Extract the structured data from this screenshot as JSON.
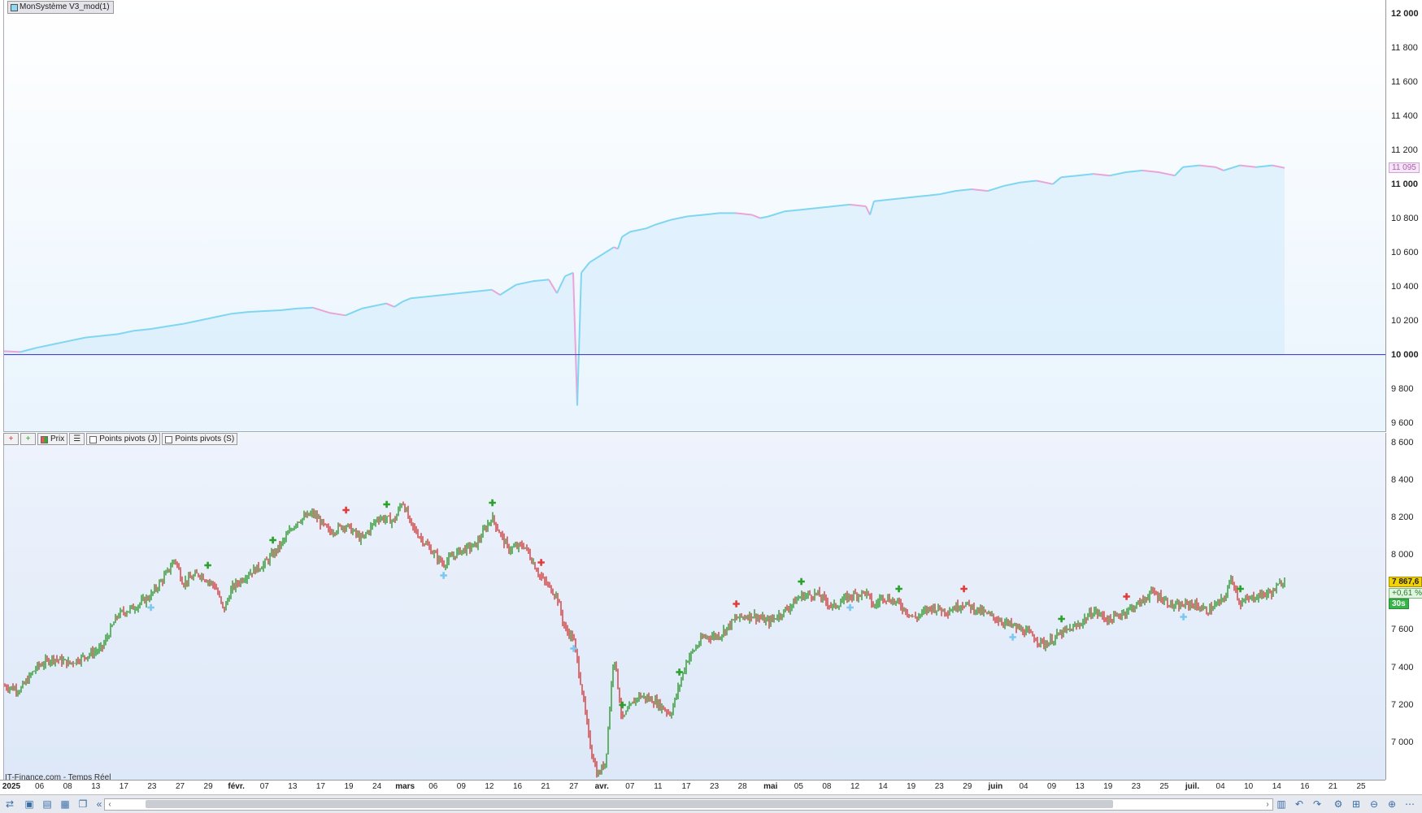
{
  "indicator": {
    "name": "MonSystème V3_mod(1)"
  },
  "upper_axis": {
    "ticks": [
      "12 000",
      "11 800",
      "11 600",
      "11 400",
      "11 200",
      "11 000",
      "10 800",
      "10 600",
      "10 400",
      "10 200",
      "10 000",
      "9 800",
      "9 600"
    ],
    "current_value": "11 095"
  },
  "legend": {
    "add_btn": "+",
    "move_btn": "+",
    "prix": "Prix",
    "list_btn": "☰",
    "pivots_j": "Points pivots (J)",
    "pivots_s": "Points pivots (S)"
  },
  "lower_axis": {
    "ticks": [
      "8 600",
      "8 400",
      "8 200",
      "8 000",
      "7 800",
      "7 600",
      "7 400",
      "7 200",
      "7 000"
    ],
    "last_price": "7 867,6",
    "change": "+0,61 %",
    "timer": "30s"
  },
  "source": "IT-Finance.com - Temps Réel",
  "x_axis": {
    "labels": [
      "2025",
      "06",
      "08",
      "13",
      "17",
      "23",
      "27",
      "29",
      "févr.",
      "07",
      "13",
      "17",
      "19",
      "24",
      "mars",
      "06",
      "09",
      "12",
      "16",
      "21",
      "27",
      "avr.",
      "07",
      "11",
      "17",
      "23",
      "28",
      "mai",
      "05",
      "08",
      "12",
      "14",
      "19",
      "23",
      "29",
      "juin",
      "04",
      "09",
      "13",
      "19",
      "23",
      "25",
      "juil.",
      "04",
      "10",
      "14",
      "16",
      "21",
      "25"
    ],
    "major": [
      "2025",
      "févr.",
      "mars",
      "avr.",
      "mai",
      "juin",
      "juil."
    ]
  },
  "colors": {
    "equity_line": "#7fd6f0",
    "equity_fill": "#d9eefc",
    "equity_pink": "#e8a6d8",
    "baseline": "#4646c8",
    "candle_up": "#2f9a2f",
    "candle_down": "#d43c3c",
    "buy_marker": "#2aa12a",
    "sell_marker": "#e23b3b",
    "pivot_marker": "#7cc8f0",
    "last_price_bg": "#f2d200",
    "change_bg": "#dff5df",
    "timer_bg": "#38b54a"
  },
  "chart_data": [
    {
      "type": "area",
      "title": "",
      "ylim": [
        9550,
        12080
      ],
      "baseline": 10000,
      "series": [
        {
          "values": [
            [
              0,
              10020
            ],
            [
              20,
              10015
            ],
            [
              40,
              10040
            ],
            [
              60,
              10060
            ],
            [
              80,
              10080
            ],
            [
              100,
              10100
            ],
            [
              120,
              10110
            ],
            [
              140,
              10120
            ],
            [
              160,
              10140
            ],
            [
              180,
              10150
            ],
            [
              200,
              10165
            ],
            [
              220,
              10180
            ],
            [
              240,
              10200
            ],
            [
              260,
              10220
            ],
            [
              280,
              10240
            ],
            [
              300,
              10250
            ],
            [
              320,
              10255
            ],
            [
              340,
              10260
            ],
            [
              360,
              10270
            ],
            [
              380,
              10275
            ],
            [
              400,
              10245
            ],
            [
              420,
              10230
            ],
            [
              440,
              10270
            ],
            [
              460,
              10290
            ],
            [
              470,
              10300
            ],
            [
              480,
              10280
            ],
            [
              490,
              10310
            ],
            [
              500,
              10330
            ],
            [
              520,
              10340
            ],
            [
              540,
              10350
            ],
            [
              560,
              10360
            ],
            [
              580,
              10370
            ],
            [
              600,
              10380
            ],
            [
              610,
              10350
            ],
            [
              630,
              10410
            ],
            [
              650,
              10430
            ],
            [
              670,
              10440
            ],
            [
              680,
              10360
            ],
            [
              690,
              10460
            ],
            [
              700,
              10480
            ],
            [
              705,
              9700
            ],
            [
              710,
              10480
            ],
            [
              720,
              10540
            ],
            [
              740,
              10600
            ],
            [
              750,
              10630
            ],
            [
              755,
              10620
            ],
            [
              760,
              10690
            ],
            [
              770,
              10720
            ],
            [
              790,
              10740
            ],
            [
              800,
              10760
            ],
            [
              820,
              10790
            ],
            [
              840,
              10810
            ],
            [
              860,
              10820
            ],
            [
              880,
              10830
            ],
            [
              900,
              10830
            ],
            [
              920,
              10820
            ],
            [
              930,
              10800
            ],
            [
              940,
              10810
            ],
            [
              960,
              10840
            ],
            [
              980,
              10850
            ],
            [
              1000,
              10860
            ],
            [
              1020,
              10870
            ],
            [
              1040,
              10880
            ],
            [
              1060,
              10870
            ],
            [
              1065,
              10820
            ],
            [
              1070,
              10900
            ],
            [
              1090,
              10910
            ],
            [
              1110,
              10920
            ],
            [
              1130,
              10930
            ],
            [
              1150,
              10940
            ],
            [
              1170,
              10960
            ],
            [
              1190,
              10970
            ],
            [
              1210,
              10960
            ],
            [
              1230,
              10990
            ],
            [
              1250,
              11010
            ],
            [
              1270,
              11020
            ],
            [
              1290,
              11000
            ],
            [
              1300,
              11040
            ],
            [
              1320,
              11050
            ],
            [
              1340,
              11060
            ],
            [
              1360,
              11050
            ],
            [
              1380,
              11070
            ],
            [
              1400,
              11080
            ],
            [
              1420,
              11070
            ],
            [
              1440,
              11050
            ],
            [
              1450,
              11100
            ],
            [
              1470,
              11110
            ],
            [
              1490,
              11100
            ],
            [
              1500,
              11080
            ],
            [
              1520,
              11110
            ],
            [
              1540,
              11100
            ],
            [
              1560,
              11110
            ],
            [
              1575,
              11095
            ]
          ]
        }
      ]
    },
    {
      "type": "candlestick",
      "title": "",
      "ylim": [
        6800,
        8650
      ],
      "series": [
        {
          "name": "Prix",
          "values": [
            [
              0,
              7300
            ],
            [
              20,
              7280
            ],
            [
              40,
              7400
            ],
            [
              60,
              7450
            ],
            [
              80,
              7420
            ],
            [
              100,
              7460
            ],
            [
              120,
              7500
            ],
            [
              140,
              7680
            ],
            [
              160,
              7720
            ],
            [
              180,
              7780
            ],
            [
              200,
              7900
            ],
            [
              210,
              7980
            ],
            [
              220,
              7850
            ],
            [
              240,
              7900
            ],
            [
              260,
              7830
            ],
            [
              270,
              7700
            ],
            [
              280,
              7820
            ],
            [
              300,
              7900
            ],
            [
              320,
              7950
            ],
            [
              340,
              8050
            ],
            [
              360,
              8180
            ],
            [
              380,
              8220
            ],
            [
              400,
              8120
            ],
            [
              420,
              8160
            ],
            [
              440,
              8080
            ],
            [
              460,
              8200
            ],
            [
              480,
              8180
            ],
            [
              490,
              8290
            ],
            [
              500,
              8160
            ],
            [
              520,
              8050
            ],
            [
              540,
              7950
            ],
            [
              560,
              8020
            ],
            [
              580,
              8050
            ],
            [
              600,
              8200
            ],
            [
              620,
              8030
            ],
            [
              640,
              8050
            ],
            [
              660,
              7880
            ],
            [
              680,
              7780
            ],
            [
              690,
              7600
            ],
            [
              700,
              7560
            ],
            [
              710,
              7300
            ],
            [
              720,
              7000
            ],
            [
              730,
              6820
            ],
            [
              740,
              6900
            ],
            [
              750,
              7480
            ],
            [
              760,
              7120
            ],
            [
              780,
              7250
            ],
            [
              800,
              7220
            ],
            [
              820,
              7150
            ],
            [
              840,
              7440
            ],
            [
              860,
              7560
            ],
            [
              880,
              7570
            ],
            [
              900,
              7660
            ],
            [
              920,
              7680
            ],
            [
              940,
              7640
            ],
            [
              960,
              7700
            ],
            [
              980,
              7780
            ],
            [
              1000,
              7790
            ],
            [
              1020,
              7720
            ],
            [
              1040,
              7780
            ],
            [
              1060,
              7800
            ],
            [
              1070,
              7720
            ],
            [
              1080,
              7780
            ],
            [
              1100,
              7740
            ],
            [
              1120,
              7660
            ],
            [
              1140,
              7720
            ],
            [
              1160,
              7700
            ],
            [
              1180,
              7740
            ],
            [
              1200,
              7700
            ],
            [
              1220,
              7660
            ],
            [
              1240,
              7620
            ],
            [
              1260,
              7580
            ],
            [
              1280,
              7520
            ],
            [
              1300,
              7580
            ],
            [
              1320,
              7620
            ],
            [
              1340,
              7700
            ],
            [
              1360,
              7650
            ],
            [
              1380,
              7700
            ],
            [
              1400,
              7750
            ],
            [
              1410,
              7800
            ],
            [
              1420,
              7780
            ],
            [
              1440,
              7720
            ],
            [
              1460,
              7740
            ],
            [
              1480,
              7700
            ],
            [
              1500,
              7760
            ],
            [
              1510,
              7880
            ],
            [
              1520,
              7740
            ],
            [
              1540,
              7780
            ],
            [
              1560,
              7800
            ],
            [
              1575,
              7868
            ]
          ]
        }
      ]
    }
  ]
}
